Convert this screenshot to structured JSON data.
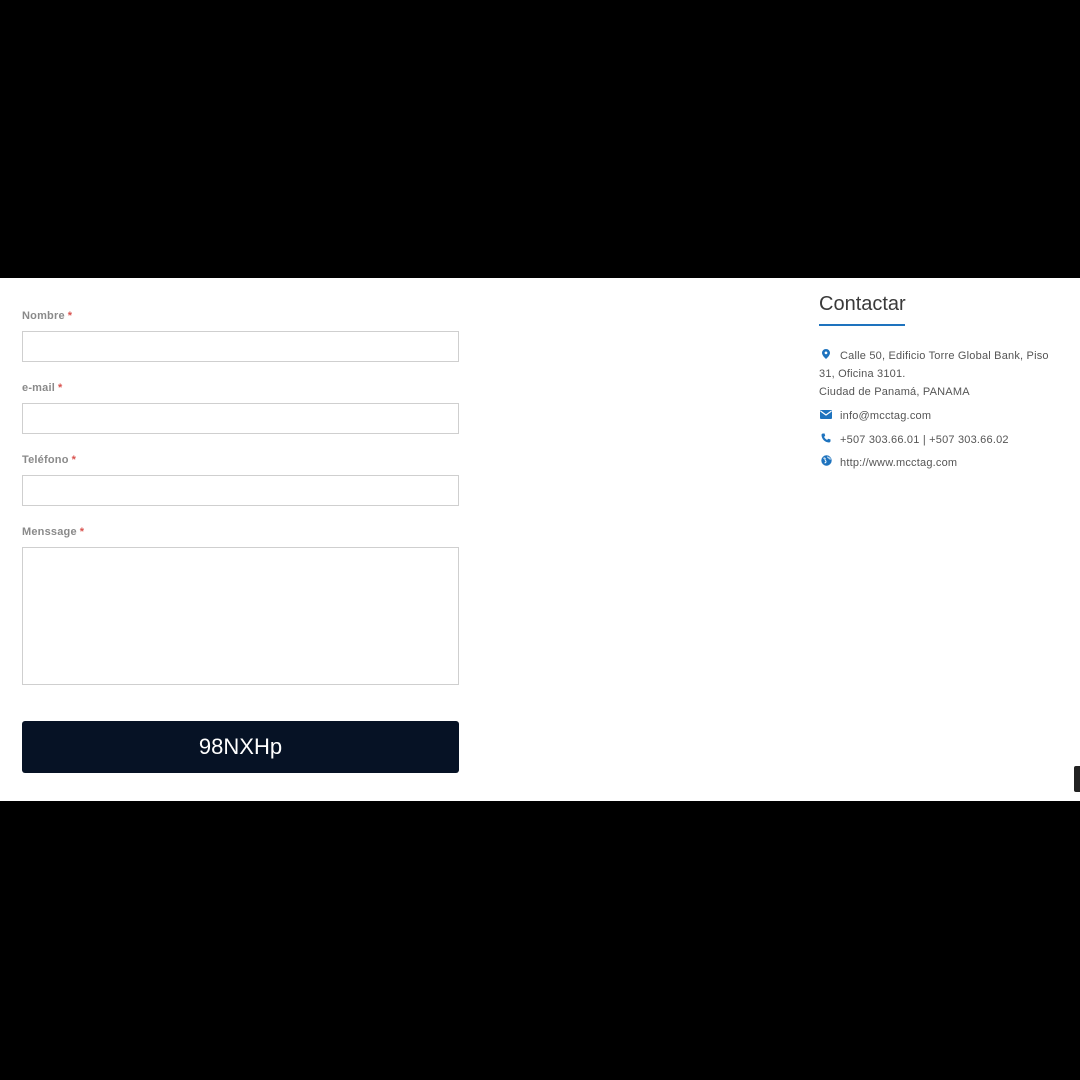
{
  "form": {
    "name_label": "Nombre",
    "email_label": "e-mail",
    "phone_label": "Teléfono",
    "message_label": "Menssage",
    "required_marker": "*",
    "captcha_text": "98NXHp"
  },
  "contact": {
    "title": "Contactar",
    "address": "Calle 50, Edificio Torre Global Bank, Piso 31, Oficina 3101.",
    "city": "Ciudad de Panamá, PANAMA",
    "email": "info@mcctag.com",
    "phone": "+507 303.66.01 | +507 303.66.02",
    "website": "http://www.mcctag.com",
    "icons": {
      "address": "map-marker-icon",
      "email": "envelope-icon",
      "phone": "phone-icon",
      "website": "globe-icon"
    }
  },
  "colors": {
    "accent": "#1e73be",
    "required": "#d9534f",
    "captcha_bg": "#061225"
  }
}
